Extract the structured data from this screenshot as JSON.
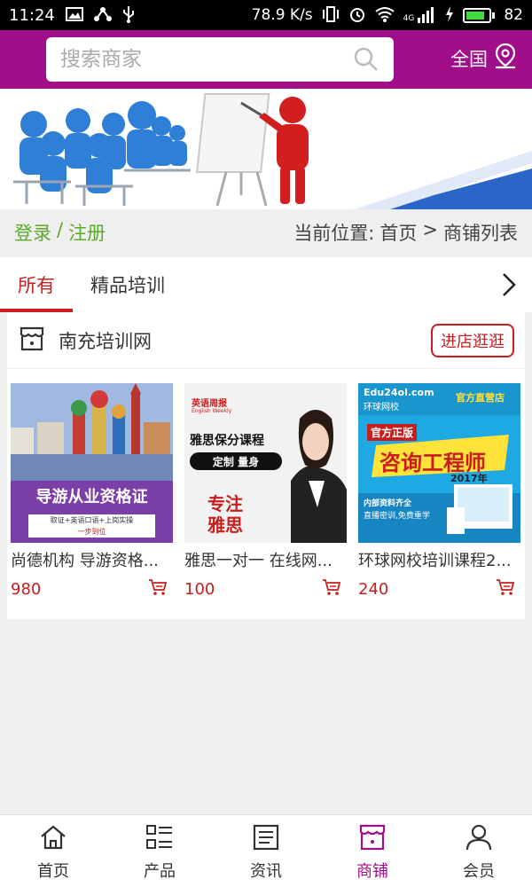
{
  "status_bar": {
    "time": "11:24",
    "speed": "78.9 K/s",
    "network": "4G",
    "battery": "82"
  },
  "header": {
    "search_placeholder": "搜索商家",
    "region_label": "全国"
  },
  "crumb": {
    "login": "登录",
    "separator": "/",
    "register": "注册",
    "location_label": "当前位置:",
    "home": "首页",
    "arrow": ">",
    "current": "商铺列表"
  },
  "tabs": [
    {
      "label": "所有",
      "active": true
    },
    {
      "label": "精品培训",
      "active": false
    }
  ],
  "shop": {
    "name": "南充培训网",
    "visit_label": "进店逛逛",
    "products": [
      {
        "title": "尚德机构 导游资格...",
        "price": "980",
        "thumb_caption": "导游从业资格证",
        "thumb_sub": "取证+英语口语+上岗实操",
        "thumb_sub2": "一步到位"
      },
      {
        "title": "雅思一对一 在线网...",
        "price": "100",
        "thumb_brand": "英语周报",
        "thumb_brand_sub": "English Weekly",
        "thumb_head": "雅思保分课程",
        "thumb_tag": "定制 量身",
        "thumb_focus": "专注",
        "thumb_focus2": "雅思"
      },
      {
        "title": "环球网校培训课程2...",
        "price": "240",
        "thumb_logo": "Edu24ol.com",
        "thumb_logo_sub": "环球网校",
        "thumb_store": "官方直营店",
        "thumb_badge": "官方正版",
        "thumb_main": "咨询工程师",
        "thumb_year": "2017年",
        "thumb_foot1": "内部资料齐全",
        "thumb_foot2": "直播密训,免费重学"
      }
    ]
  },
  "bottom_nav": [
    {
      "label": "首页",
      "icon": "home-icon"
    },
    {
      "label": "产品",
      "icon": "list-icon"
    },
    {
      "label": "资讯",
      "icon": "news-icon"
    },
    {
      "label": "商铺",
      "icon": "store-icon",
      "active": true
    },
    {
      "label": "会员",
      "icon": "user-icon"
    }
  ],
  "colors": {
    "brand": "#a10e8a",
    "accent_red": "#c81e1e",
    "login_green": "#5aa929"
  }
}
